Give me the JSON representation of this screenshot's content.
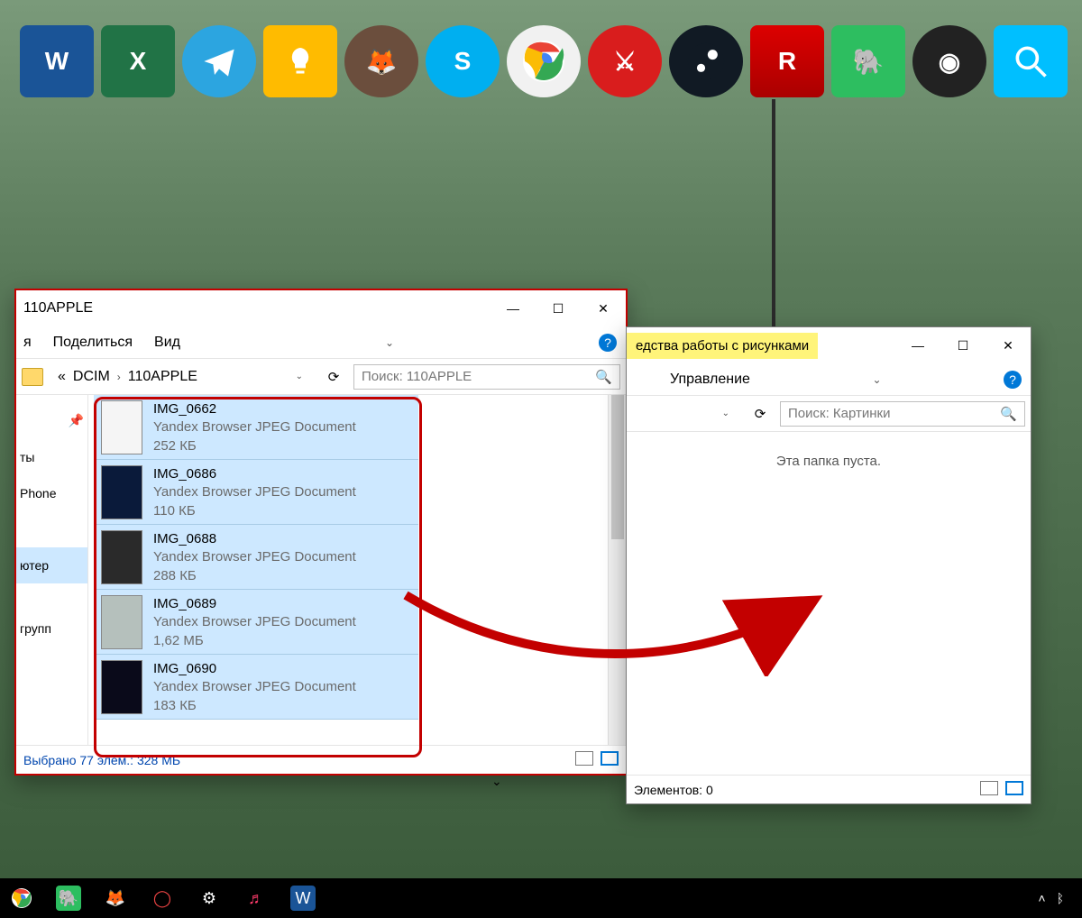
{
  "windows": {
    "left": {
      "title": "110APPLE",
      "menu": {
        "share": "Поделиться",
        "view": "Вид"
      },
      "breadcrumb": {
        "a": "DCIM",
        "b": "110APPLE"
      },
      "search_placeholder": "Поиск: 110APPLE",
      "sidebar": {
        "pin": "ты",
        "phone": "Phone",
        "computer": "ютер",
        "groups": "групп"
      },
      "files": [
        {
          "name": "IMG_0662",
          "type": "Yandex Browser JPEG Document",
          "size": "252 КБ"
        },
        {
          "name": "IMG_0686",
          "type": "Yandex Browser JPEG Document",
          "size": "110 КБ"
        },
        {
          "name": "IMG_0688",
          "type": "Yandex Browser JPEG Document",
          "size": "288 КБ"
        },
        {
          "name": "IMG_0689",
          "type": "Yandex Browser JPEG Document",
          "size": "1,62 МБ"
        },
        {
          "name": "IMG_0690",
          "type": "Yandex Browser JPEG Document",
          "size": "183 КБ"
        }
      ],
      "status": "Выбрано 77 элем.: 328 МБ"
    },
    "right": {
      "tab": "едства работы с рисунками",
      "manage": "Управление",
      "search_placeholder": "Поиск: Картинки",
      "empty": "Эта папка пуста.",
      "status": "Элементов: 0"
    }
  }
}
